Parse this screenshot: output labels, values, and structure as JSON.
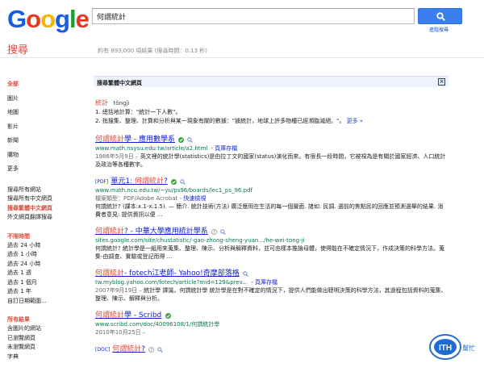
{
  "header": {
    "logo_letters": [
      "G",
      "o",
      "o",
      "g",
      "l",
      "e"
    ],
    "search_value": "何謂統計",
    "advanced_link": "進階搜尋",
    "search_icon": "search-icon"
  },
  "product_title": "搜尋",
  "stats_text": "約有 893,000 項結果 (搜尋時間：0.13 秒)",
  "sidebar": {
    "types": [
      {
        "label": "全部",
        "active": true
      },
      {
        "label": "圖片",
        "active": false
      },
      {
        "label": "地圖",
        "active": false
      },
      {
        "label": "影片",
        "active": false
      },
      {
        "label": "新聞",
        "active": false
      },
      {
        "label": "購物",
        "active": false
      },
      {
        "label": "更多",
        "active": false
      }
    ],
    "languages": [
      {
        "label": "搜尋所有網站",
        "active": false
      },
      {
        "label": "搜尋所有中文網頁",
        "active": false
      },
      {
        "label": "搜尋繁體中文網頁",
        "active": true
      },
      {
        "label": "外文網頁翻譯搜尋",
        "active": false
      }
    ],
    "time_title": "不限時間",
    "time_items": [
      "過去 24 小時",
      "過去 1 小時",
      "過去 24 小時",
      "過去 1 週",
      "過去 1 個月",
      "過去 1 年",
      "自訂日期範圍..."
    ],
    "results_title": "所有結果",
    "results_items": [
      "含圖片的網站",
      "已瀏覽網頁",
      "未瀏覽網頁",
      "字典"
    ]
  },
  "banner": {
    "text": "搜尋繁體中文網頁",
    "close_label": "×"
  },
  "dictionary": {
    "word": "統計",
    "pinyin": "tǒngjì",
    "def1": "1. 總括地計算：\"統計一下人數\"。",
    "def2": "2. 指搜集、整理、計算和分析與某一現象有關的數據：\"據統計，地球上許多物種已經瀕臨滅絕。\"。",
    "more": "更多 »"
  },
  "results": [
    {
      "tag": "",
      "title_pre": "",
      "title_hl": "何謂統計",
      "title_post": "學 - 應用數學系",
      "url": "www.math.nsysu.edu.tw/article/a2.html",
      "cache": "- 頁庫存檔",
      "date": "1986年5月9日 –",
      "snippet": "英文裡的統計學(statistics)是由拉丁文的國家(status)演化而來。有很長一段時間，它被視為是有關於國家經濟、人口統計及政治等各種數字。"
    },
    {
      "tag": "[PDF]",
      "title_pre": "單元1: ",
      "title_hl": "何謂統計",
      "title_post": "?",
      "url": "www.math.ncu.edu.tw/~yu/ps96/boards/lec1_ps_96.pdf",
      "filetype_label": "檔案類型：PDF/Adobe Acrobat -",
      "filetype_link": "快速檢視",
      "snippet": "何謂統計? (課本:x.1-x.1.5). — 簡介. 統計技術(方法) 廣泛應用在生活的每一個層面. 諸如: 民調. 選前的焦點民的回應並預測選舉的結果. 消費者意見: 提供資訊以便 ..."
    },
    {
      "tag": "",
      "title_pre": "",
      "title_hl": "何謂統計",
      "title_post": "? - 中華大學應用統計學系",
      "url": "sites.google.com/site/chustatistic/-gao-zhong-sheng-yuan.../he-wei-tong-ji",
      "snippet": "何謂統計? 統計學是一組用來蒐集、整理、陳示、分析與解釋資料，並可由樣本推論母體，使得能在不確定情況下，作成決策的科學方法。蒐集-由調查、實驗或登記而得 ..."
    },
    {
      "tag": "",
      "title_pre": "",
      "title_hl": "何謂統計",
      "title_post": "- fotech江老師- Yahoo!奇摩部落格",
      "url": "tw.myblog.yahoo.com/fotech/article?mid=129&prev...",
      "cache": "- 頁庫存檔",
      "date": "2007年9月19日 –",
      "snippet": "統計學 譯識，何謂統計學 統計學是在對不確定的情況下，提供人們能做出聰明決策的科學方法，其過程包括資料的蒐集、整理、陳示、解釋與分析。"
    },
    {
      "tag": "",
      "title_pre": "",
      "title_hl": "何謂統計",
      "title_post": "學 - Scribd",
      "url": "www.scribd.com/doc/40096108/1/何謂統計學",
      "date": "2010年10月25日 –"
    },
    {
      "tag": "[DOC]",
      "title_pre": "",
      "title_hl": "何謂統計",
      "title_post": "?",
      "url": ""
    }
  ],
  "badge": {
    "text": "ITH",
    "subtext": "幫忙"
  },
  "colors": {
    "accent_red": "#dd4b39",
    "link_blue": "#1122cc",
    "url_green": "#0e774a",
    "button_blue": "#3a7ff0"
  }
}
